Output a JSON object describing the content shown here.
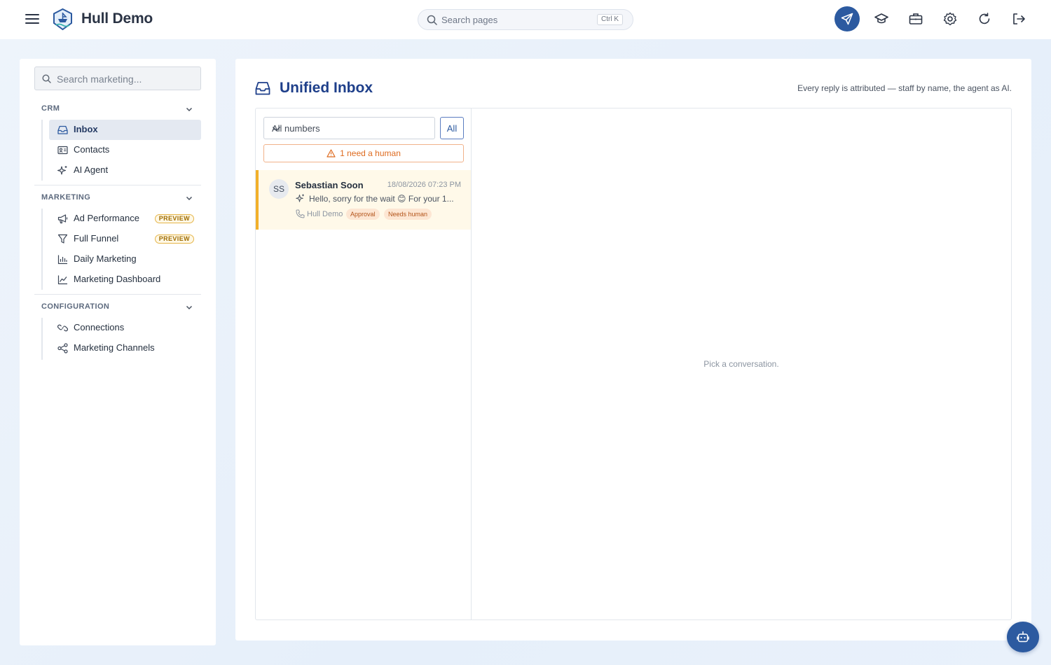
{
  "app": {
    "title": "Hull Demo"
  },
  "topbar": {
    "search_placeholder": "Search pages",
    "search_shortcut": "Ctrl K",
    "actions": [
      "send-icon",
      "graduation-cap-icon",
      "briefcase-icon",
      "gear-icon",
      "refresh-icon",
      "logout-icon"
    ]
  },
  "sidebar": {
    "search_placeholder": "Search marketing...",
    "sections": [
      {
        "title": "CRM",
        "items": [
          {
            "label": "Inbox",
            "icon": "inbox-icon",
            "active": true
          },
          {
            "label": "Contacts",
            "icon": "contact-card-icon"
          },
          {
            "label": "AI Agent",
            "icon": "sparkles-icon"
          }
        ]
      },
      {
        "title": "MARKETING",
        "items": [
          {
            "label": "Ad Performance",
            "icon": "megaphone-icon",
            "badge": "PREVIEW"
          },
          {
            "label": "Full Funnel",
            "icon": "funnel-icon",
            "badge": "PREVIEW"
          },
          {
            "label": "Daily Marketing",
            "icon": "bar-chart-icon"
          },
          {
            "label": "Marketing Dashboard",
            "icon": "line-chart-icon"
          }
        ]
      },
      {
        "title": "CONFIGURATION",
        "items": [
          {
            "label": "Connections",
            "icon": "link-icon"
          },
          {
            "label": "Marketing Channels",
            "icon": "share-icon"
          }
        ]
      }
    ]
  },
  "main": {
    "title": "Unified Inbox",
    "attribution": "Every reply is attributed — staff by name, the agent as AI.",
    "number_filter": "All numbers",
    "all_button": "All",
    "need_human": "1 need a human",
    "conversations": [
      {
        "initials": "SS",
        "name": "Sebastian Soon",
        "time": "18/08/2026 07:23 PM",
        "preview": "Hello, sorry for the wait 😊 For your 1...",
        "channel": "Hull Demo",
        "tags": [
          "Approval",
          "Needs human"
        ]
      }
    ],
    "empty_message": "Pick a conversation."
  },
  "colors": {
    "accent": "#2c5aa0",
    "title_blue": "#1e3f8a",
    "warning_orange": "#de6b1f",
    "highlight_row": "#fff9e9",
    "row_border": "#f2b02a"
  }
}
